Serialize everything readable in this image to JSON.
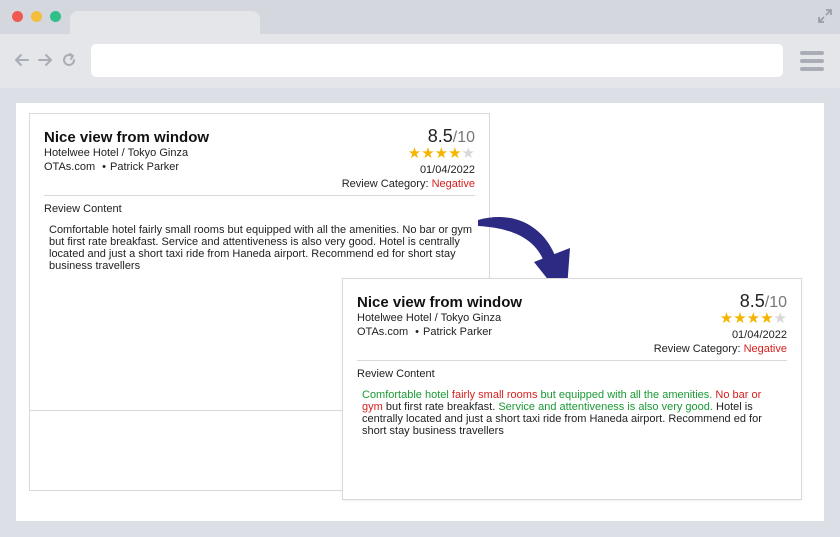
{
  "browser": {
    "url": "",
    "colors": {
      "close": "#ee5a52",
      "minimize": "#f4bd3b",
      "maximize": "#2fc08a"
    }
  },
  "review": {
    "title": "Nice view from window",
    "hotel": "Hotelwee Hotel / Tokyo Ginza",
    "source": "OTAs.com",
    "separator": "•",
    "reviewer": "Patrick Parker",
    "score": "8.5",
    "score_max": "/10",
    "stars": {
      "rating": 4,
      "max": 5,
      "glyph": "★"
    },
    "date": "01/04/2022",
    "category_label": "Review Category:",
    "category_value": "Negative",
    "content_label": "Review Content",
    "content_plain": "Comfortable  hotel fairly small rooms but equipped with all the amenities. No bar or gym but first rate breakfast. Service and attentiveness is also very good. Hotel is centrally located and just a short taxi ride from Haneda airport. Recommend ed for short stay business travellers",
    "content_highlighted": [
      {
        "text": "Comfortable  hotel ",
        "sentiment": "positive"
      },
      {
        "text": "fairly small rooms",
        "sentiment": "negative"
      },
      {
        "text": " but equipped with all the amenities. ",
        "sentiment": "positive"
      },
      {
        "text": "No bar or gym",
        "sentiment": "negative"
      },
      {
        "text": " but first rate breakfast. ",
        "sentiment": "neutral"
      },
      {
        "text": "Service and attentiveness is also very good.",
        "sentiment": "positive"
      },
      {
        "text": " Hotel is centrally located and just a short taxi ride from Haneda airport. Recommend ed for short stay business travellers",
        "sentiment": "neutral"
      }
    ]
  },
  "colors": {
    "positive": "#1a9a35",
    "negative": "#d62020",
    "star_on": "#f4b400",
    "star_off": "#d8d8d8",
    "arrow": "#2d2a83"
  }
}
